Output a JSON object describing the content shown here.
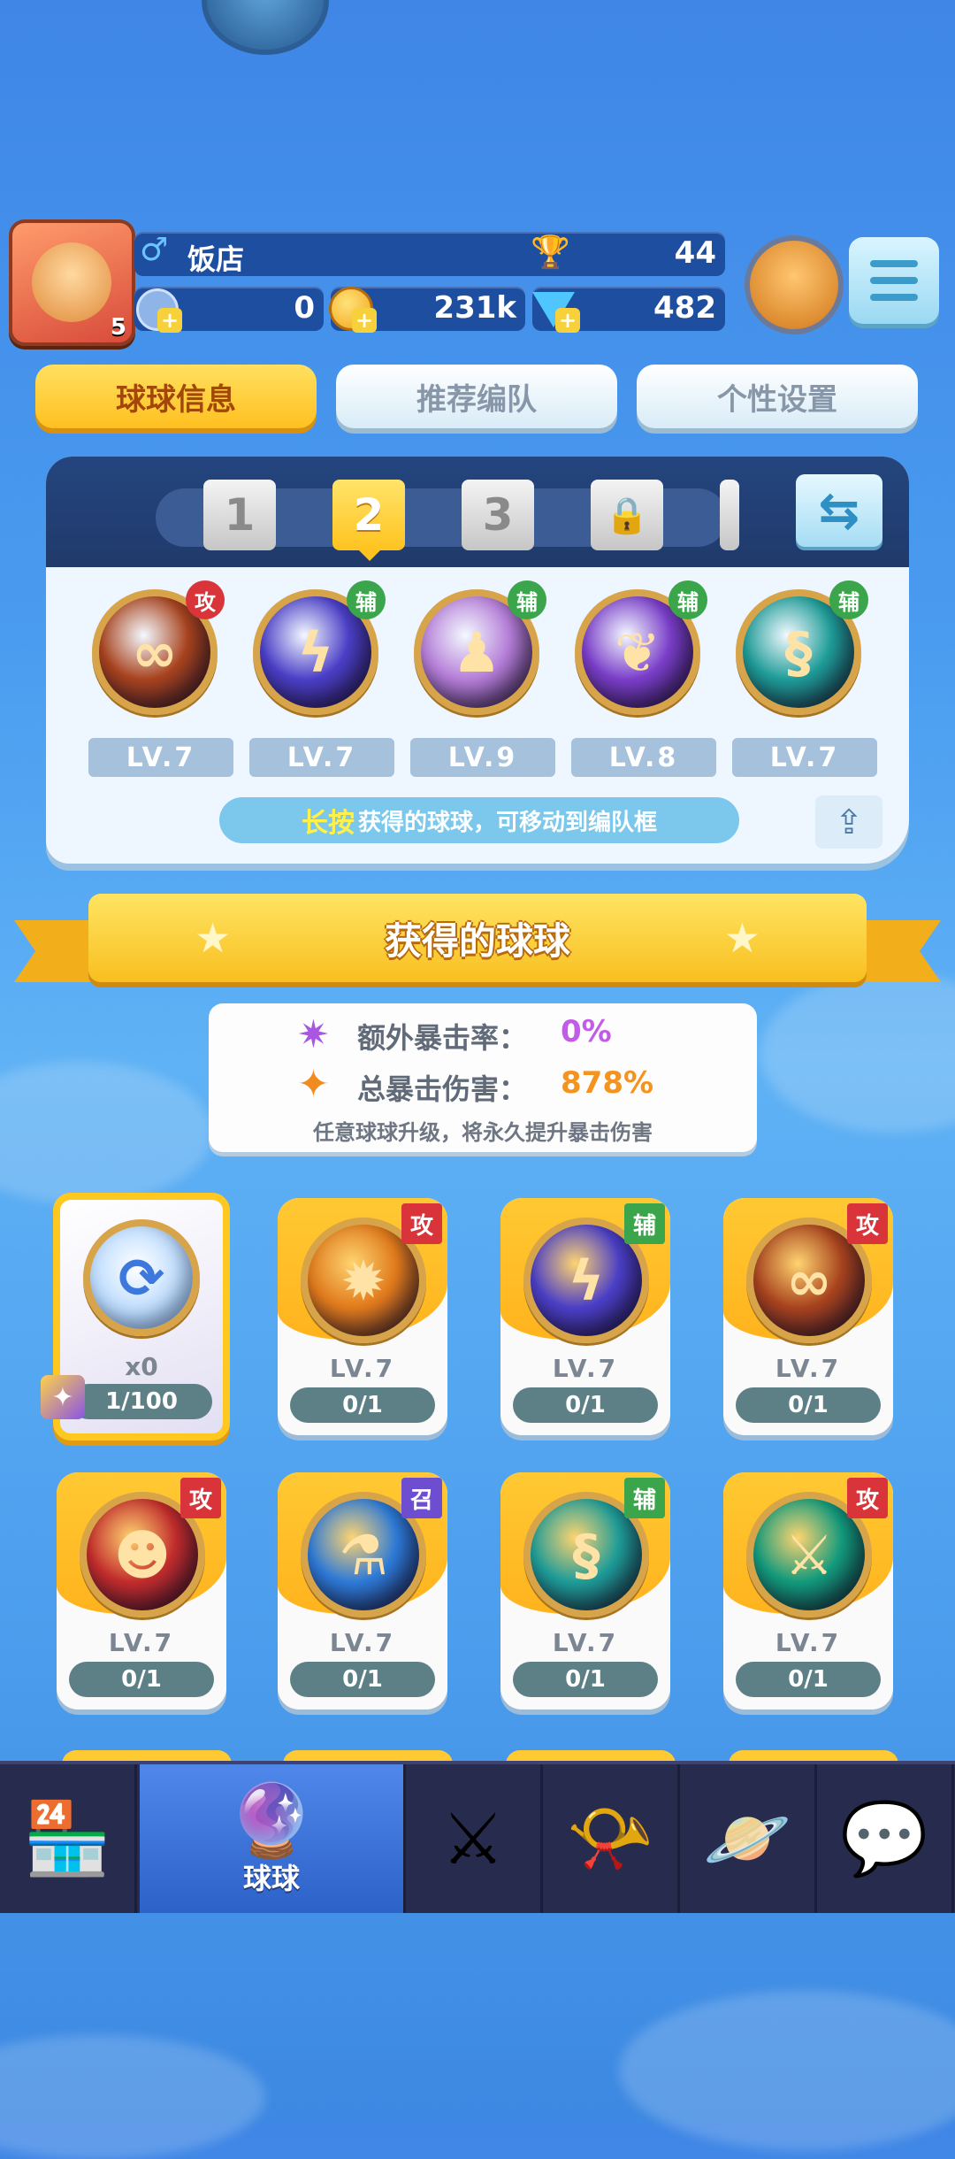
{
  "player": {
    "name": "饭店",
    "gender_icon": "♂",
    "avatar_level": "5",
    "trophies": "44",
    "energy": "0",
    "gold": "231k",
    "gems": "482"
  },
  "tabs": [
    {
      "label": "球球信息",
      "active": true
    },
    {
      "label": "推荐编队",
      "active": false
    },
    {
      "label": "个性设置",
      "active": false
    }
  ],
  "team": {
    "slots": [
      {
        "label": "1",
        "state": "inactive"
      },
      {
        "label": "2",
        "state": "active"
      },
      {
        "label": "3",
        "state": "inactive"
      },
      {
        "label": "",
        "state": "locked"
      }
    ],
    "balls": [
      {
        "tag": "攻",
        "tag_type": "atk",
        "level": "LV.7",
        "glyph": "∞",
        "color": "#a8431e"
      },
      {
        "tag": "辅",
        "tag_type": "sup",
        "level": "LV.7",
        "glyph": "ϟ",
        "color": "#4b3fc7"
      },
      {
        "tag": "辅",
        "tag_type": "sup",
        "level": "LV.9",
        "glyph": "♟",
        "color": "#b57ed8"
      },
      {
        "tag": "辅",
        "tag_type": "sup",
        "level": "LV.8",
        "glyph": "❦",
        "color": "#7a3ec9"
      },
      {
        "tag": "辅",
        "tag_type": "sup",
        "level": "LV.7",
        "glyph": "§",
        "color": "#1e9c98"
      }
    ],
    "hint_em": "长按",
    "hint_rest": "获得的球球，可移动到编队框"
  },
  "banner_title": "获得的球球",
  "crit": {
    "extra_rate_label": "额外暴击率：",
    "extra_rate_value": "0%",
    "total_damage_label": "总暴击伤害：",
    "total_damage_value": "878%",
    "note": "任意球球升级，将永久提升暴击伤害"
  },
  "special_card": {
    "count": "x0",
    "progress": "1/100"
  },
  "cards": [
    {
      "tag": "攻",
      "tag_type": "atk",
      "level": "LV.7",
      "progress": "0/1",
      "glyph": "✹",
      "color": "#e07a1c"
    },
    {
      "tag": "辅",
      "tag_type": "sup",
      "level": "LV.7",
      "progress": "0/1",
      "glyph": "ϟ",
      "color": "#4b3fc7"
    },
    {
      "tag": "攻",
      "tag_type": "atk",
      "level": "LV.7",
      "progress": "0/1",
      "glyph": "∞",
      "color": "#a8431e"
    },
    {
      "tag": "攻",
      "tag_type": "atk",
      "level": "LV.7",
      "progress": "0/1",
      "glyph": "☻",
      "color": "#c22c2c"
    },
    {
      "tag": "召",
      "tag_type": "sum",
      "level": "LV.7",
      "progress": "0/1",
      "glyph": "⚗",
      "color": "#2d7ad8"
    },
    {
      "tag": "辅",
      "tag_type": "sup",
      "level": "LV.7",
      "progress": "0/1",
      "glyph": "§",
      "color": "#1e9c98"
    },
    {
      "tag": "攻",
      "tag_type": "atk",
      "level": "LV.7",
      "progress": "0/1",
      "glyph": "⚔",
      "color": "#129a7c"
    }
  ],
  "nav": [
    {
      "icon": "shop-icon",
      "glyph": "🏪",
      "label": ""
    },
    {
      "icon": "balls-icon",
      "glyph": "🔮",
      "label": "球球",
      "active": true
    },
    {
      "icon": "battle-icon",
      "glyph": "⚔",
      "label": ""
    },
    {
      "icon": "whistle-icon",
      "glyph": "📯",
      "label": ""
    },
    {
      "icon": "planet-icon",
      "glyph": "🪐",
      "label": ""
    },
    {
      "icon": "chat-icon",
      "glyph": "💬",
      "label": ""
    }
  ]
}
